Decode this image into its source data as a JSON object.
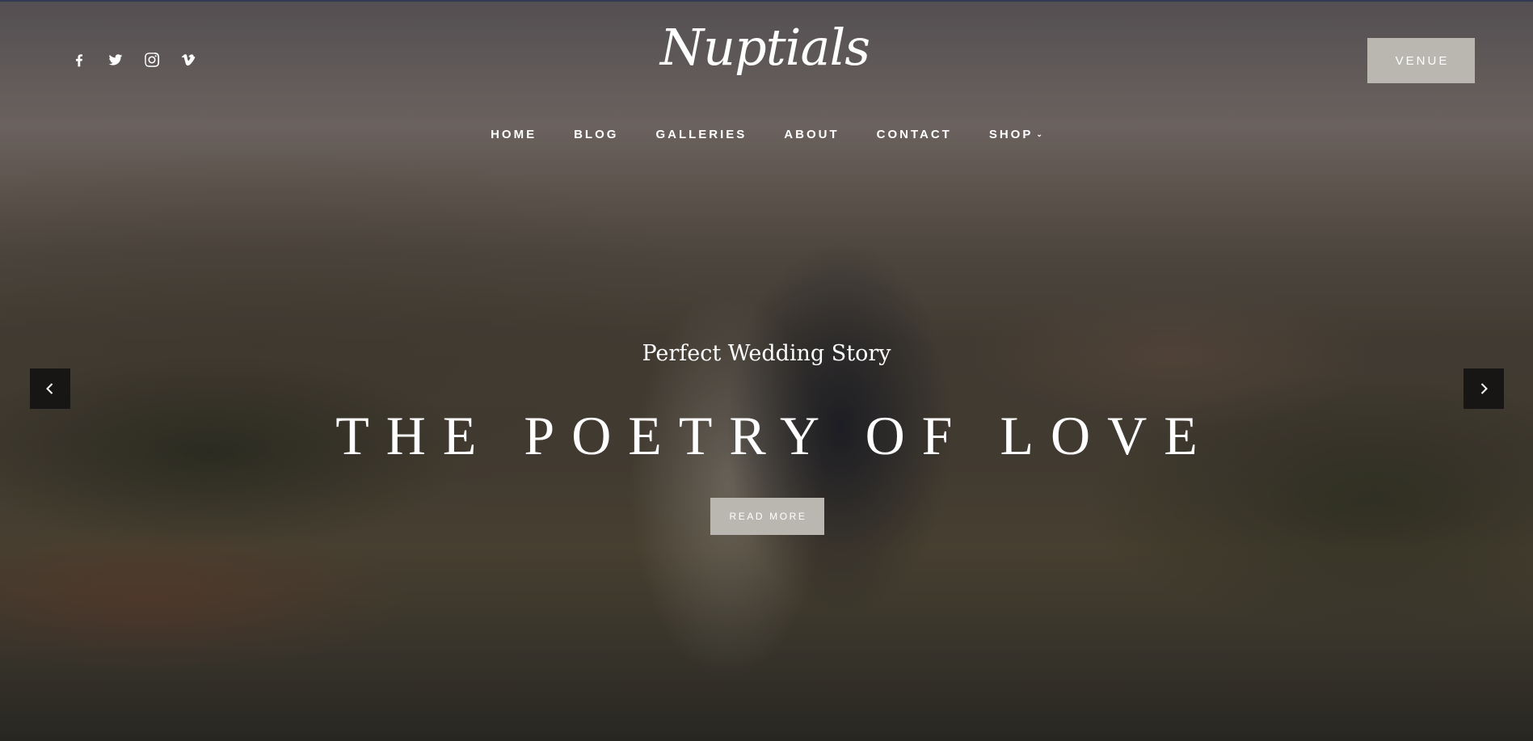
{
  "header": {
    "logo_text": "Nuptials",
    "venue_button_label": "VENUE",
    "social_icons": [
      "facebook-icon",
      "twitter-icon",
      "instagram-icon",
      "vimeo-icon"
    ]
  },
  "nav": {
    "items": [
      {
        "label": "HOME"
      },
      {
        "label": "BLOG"
      },
      {
        "label": "GALLERIES"
      },
      {
        "label": "ABOUT"
      },
      {
        "label": "CONTACT"
      },
      {
        "label": "SHOP",
        "has_dropdown": true
      }
    ],
    "dropdown_glyph": "⌄"
  },
  "slider": {
    "subtitle": "Perfect Wedding Story",
    "headline": "THE POETRY OF LOVE",
    "cta_label": "READ MORE",
    "prev_icon": "chevron-left-icon",
    "next_icon": "chevron-right-icon"
  },
  "colors": {
    "button_background": "#b9b7b0",
    "text": "#ffffff",
    "arrow_background": "#121010"
  }
}
